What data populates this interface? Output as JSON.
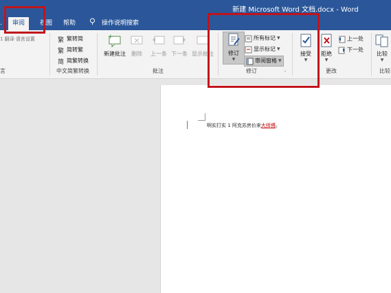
{
  "window": {
    "title": "新建 Microsoft Word 文档.docx - Word"
  },
  "tabs": [
    {
      "label": "审阅",
      "active": true
    },
    {
      "label": "视图"
    },
    {
      "label": "帮助"
    },
    {
      "label": "操作说明搜索"
    }
  ],
  "ribbon": {
    "left_group_label": "言",
    "left_partial": "",
    "chinese_conv": {
      "items": [
        "繁转简",
        "简转繁",
        "简繁转换"
      ],
      "group_label": "中文简繁转换"
    },
    "comments": {
      "new_comment": "新建批注",
      "delete": "删除",
      "previous": "上一条",
      "next": "下一条",
      "show_comments": "显示批注",
      "group_label": "批注"
    },
    "tracking": {
      "track_changes": "修订",
      "markup_select": "所有标记",
      "show_markup": "显示标记",
      "review_pane": "审阅窗格",
      "group_label": "修订"
    },
    "changes": {
      "accept": "接受",
      "reject": "拒绝",
      "previous": "上一处",
      "next": "下一处",
      "group_label": "更改"
    },
    "compare": {
      "label": "比较",
      "group_label": "比较"
    }
  },
  "document": {
    "text": "啊实打实 1 阿克苏房价来",
    "inserted": "大师傅",
    "end": "。"
  },
  "colors": {
    "accent": "#2b579a",
    "highlight": "#c0141b"
  }
}
